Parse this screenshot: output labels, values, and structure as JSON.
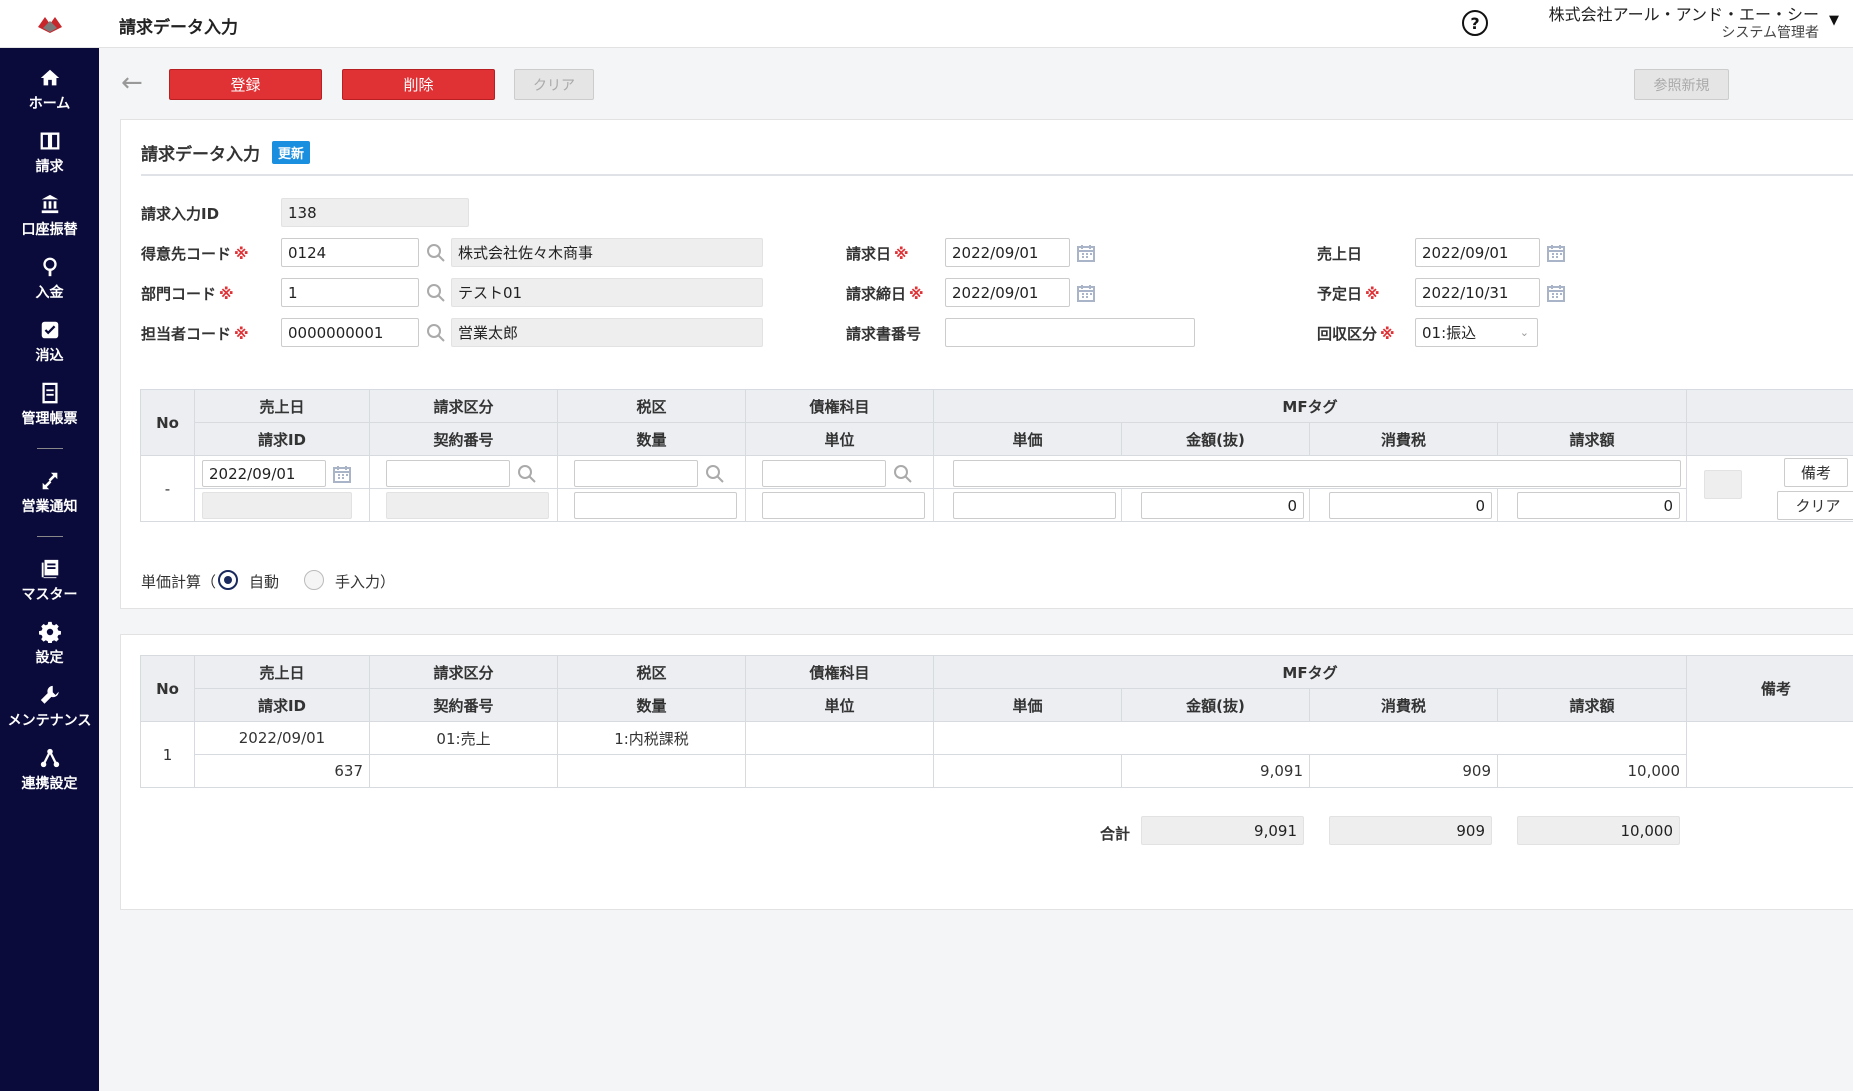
{
  "sidebar": {
    "items": [
      {
        "label": "ホーム",
        "icon": "home-icon"
      },
      {
        "label": "請求",
        "icon": "book-icon"
      },
      {
        "label": "口座振替",
        "icon": "bank-icon"
      },
      {
        "label": "入金",
        "icon": "deposit-icon"
      },
      {
        "label": "消込",
        "icon": "check-icon"
      },
      {
        "label": "管理帳票",
        "icon": "report-icon"
      },
      {
        "label": "営業通知",
        "icon": "arrows-icon"
      },
      {
        "label": "マスター",
        "icon": "master-icon"
      },
      {
        "label": "設定",
        "icon": "gear-icon"
      },
      {
        "label": "メンテナンス",
        "icon": "wrench-icon"
      },
      {
        "label": "連携設定",
        "icon": "network-icon"
      }
    ]
  },
  "header": {
    "title": "請求データ入力",
    "help": "?",
    "company": "株式会社アール・アンド・エー・シー",
    "role": "システム管理者",
    "caret": "▼"
  },
  "toolbar": {
    "back": "←",
    "register": "登録",
    "delete": "削除",
    "clear": "クリア",
    "copy_new": "参照新規"
  },
  "form": {
    "section_title": "請求データ入力",
    "badge": "更新",
    "required_mark": "※",
    "invoice_input_id_label": "請求入力ID",
    "invoice_input_id": "138",
    "customer_code_label": "得意先コード",
    "customer_code": "0124",
    "customer_name": "株式会社佐々木商事",
    "dept_code_label": "部門コード",
    "dept_code": "1",
    "dept_name": "テスト01",
    "staff_code_label": "担当者コード",
    "staff_code": "0000000001",
    "staff_name": "営業太郎",
    "invoice_date_label": "請求日",
    "invoice_date": "2022/09/01",
    "closing_date_label": "請求締日",
    "closing_date": "2022/09/01",
    "invoice_no_label": "請求書番号",
    "invoice_no": "",
    "sales_date_label": "売上日",
    "sales_date": "2022/09/01",
    "due_date_label": "予定日",
    "due_date": "2022/10/31",
    "collection_label": "回収区分",
    "collection": "01:振込"
  },
  "headers": {
    "no": "No",
    "sales_date": "売上日",
    "billing_type": "請求区分",
    "tax_type": "税区",
    "account": "債権科目",
    "mf_tag": "MFタグ",
    "invoice_id": "請求ID",
    "contract_no": "契約番号",
    "qty": "数量",
    "unit": "単位",
    "unit_price": "単価",
    "amount": "金額(抜)",
    "tax": "消費税",
    "total": "請求額",
    "remarks": "備考"
  },
  "entry": {
    "no": "-",
    "sales_date": "2022/09/01",
    "amount": "0",
    "tax": "0",
    "total": "0",
    "remarks_btn": "備考",
    "clear_btn": "クリア"
  },
  "price_calc": {
    "label": "単価計算（",
    "auto": "自動",
    "manual": "手入力）"
  },
  "lines": [
    {
      "no": "1",
      "sales_date": "2022/09/01",
      "billing_type": "01:売上",
      "tax_type": "1:内税課税",
      "invoice_id": "637",
      "amount": "9,091",
      "tax": "909",
      "total": "10,000"
    }
  ],
  "totals": {
    "label": "合計",
    "amount": "9,091",
    "tax": "909",
    "total": "10,000"
  }
}
